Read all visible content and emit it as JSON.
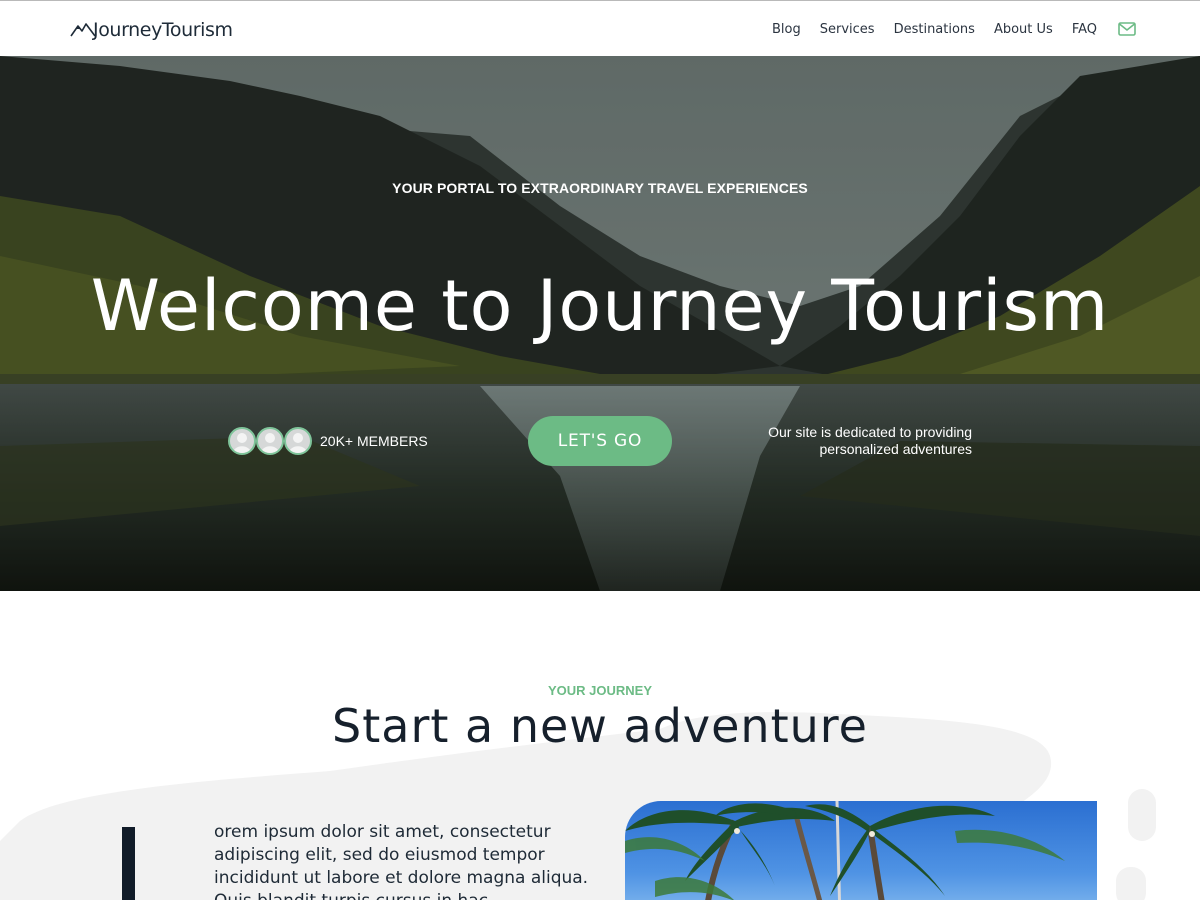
{
  "header": {
    "logo_text": "JourneyTourism",
    "nav": [
      "Blog",
      "Services",
      "Destinations",
      "About Us",
      "FAQ"
    ],
    "mail_icon": "mail-icon"
  },
  "hero": {
    "eyebrow": "YOUR PORTAL TO EXTRAORDINARY TRAVEL EXPERIENCES",
    "title": "Welcome to Journey Tourism",
    "members_label": "20K+ MEMBERS",
    "cta_label": "LET'S GO",
    "note": "Our site is dedicated to providing personalized adventures"
  },
  "journey": {
    "eyebrow": "YOUR JOURNEY",
    "title": "Start a new adventure",
    "body": "orem ipsum dolor sit amet, consectetur adipiscing elit, sed do eiusmod tempor incididunt ut labore et dolore magna aliqua. Quis blandit turpis cursus in hac"
  },
  "colors": {
    "accent": "#6cbb85",
    "heading": "#16202c",
    "header_bg": "#ffffff"
  }
}
